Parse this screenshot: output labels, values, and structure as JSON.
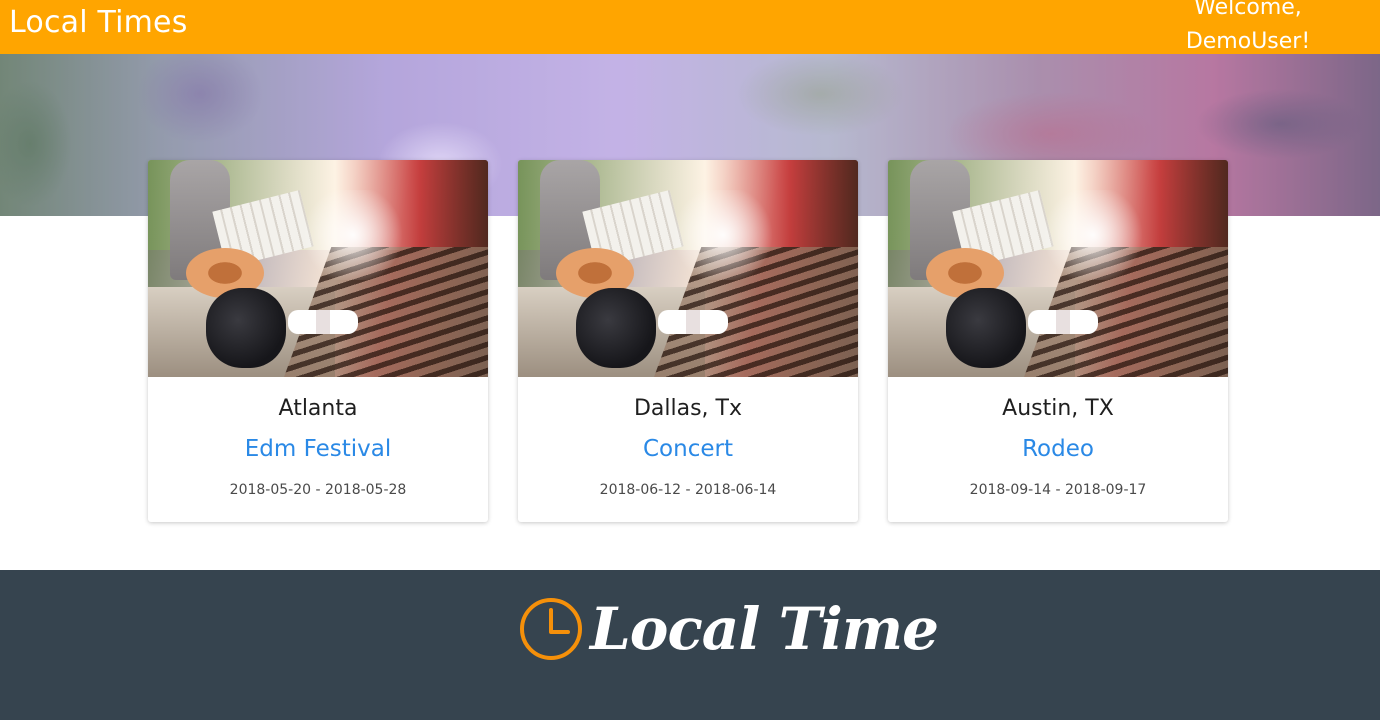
{
  "header": {
    "brand": "Local Times",
    "welcome": "Welcome, DemoUser!"
  },
  "events": [
    {
      "city": "Atlanta",
      "event": "Edm Festival",
      "dates": "2018-05-20 - 2018-05-28"
    },
    {
      "city": "Dallas, Tx",
      "event": "Concert",
      "dates": "2018-06-12 - 2018-06-14"
    },
    {
      "city": "Austin, TX",
      "event": "Rodeo",
      "dates": "2018-09-14 - 2018-09-17"
    }
  ],
  "footer": {
    "brand": "Local Time",
    "icon": "clock-icon"
  },
  "colors": {
    "header_bg": "#ffa500",
    "link": "#2a89e6",
    "footer_bg": "#36444f",
    "logo_accent": "#f5900a"
  }
}
